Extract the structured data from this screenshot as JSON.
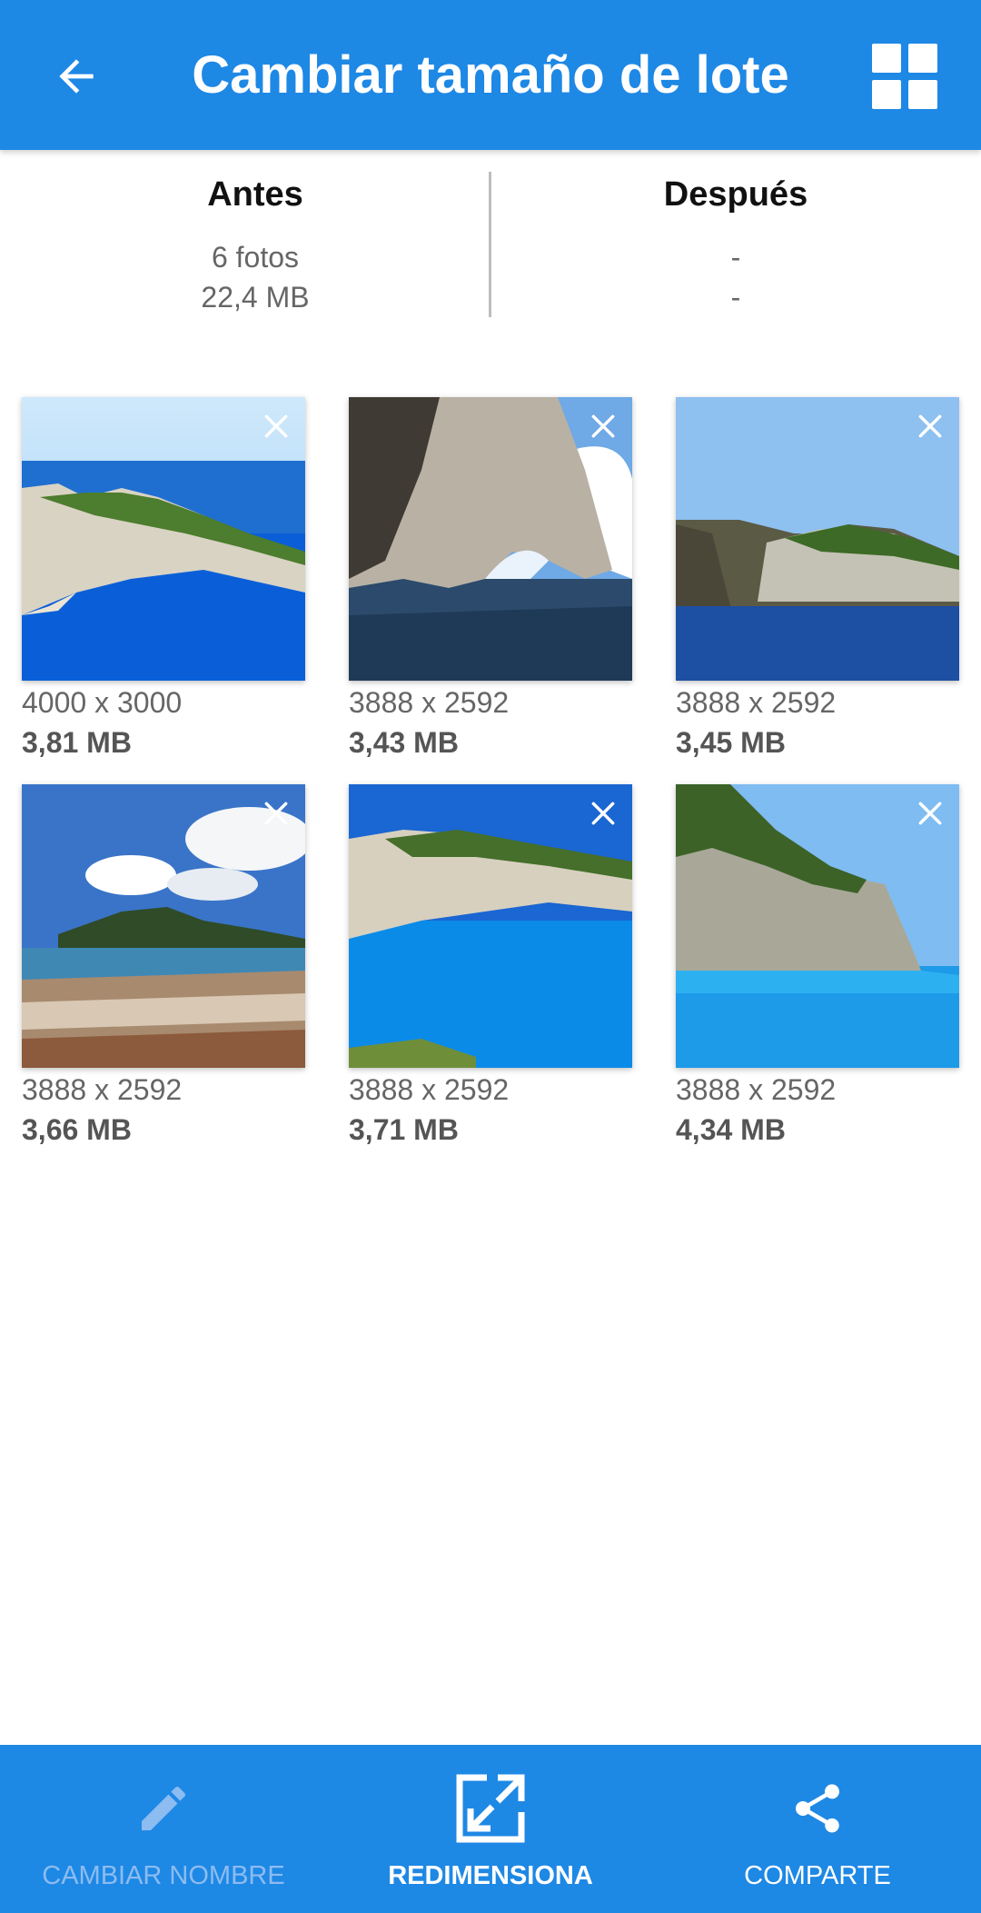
{
  "header": {
    "title": "Cambiar tamaño de lote",
    "back_icon": "arrow-back-icon",
    "view_icon": "grid-view-icon"
  },
  "summary": {
    "before": {
      "title": "Antes",
      "count": "6 fotos",
      "size": "22,4 MB"
    },
    "after": {
      "title": "Después",
      "count": "-",
      "size": "-"
    }
  },
  "photos": [
    {
      "dims": "4000 x 3000",
      "size": "3,81 MB"
    },
    {
      "dims": "3888 x 2592",
      "size": "3,43 MB"
    },
    {
      "dims": "3888 x 2592",
      "size": "3,45 MB"
    },
    {
      "dims": "3888 x 2592",
      "size": "3,66 MB"
    },
    {
      "dims": "3888 x 2592",
      "size": "3,71 MB"
    },
    {
      "dims": "3888 x 2592",
      "size": "4,34 MB"
    }
  ],
  "bottom_nav": {
    "rename": "CAMBIAR NOMBRE",
    "resize": "REDIMENSIONA",
    "share": "COMPARTE"
  },
  "colors": {
    "primary": "#1e88e5",
    "disabled_text": "#8cbcf0"
  }
}
